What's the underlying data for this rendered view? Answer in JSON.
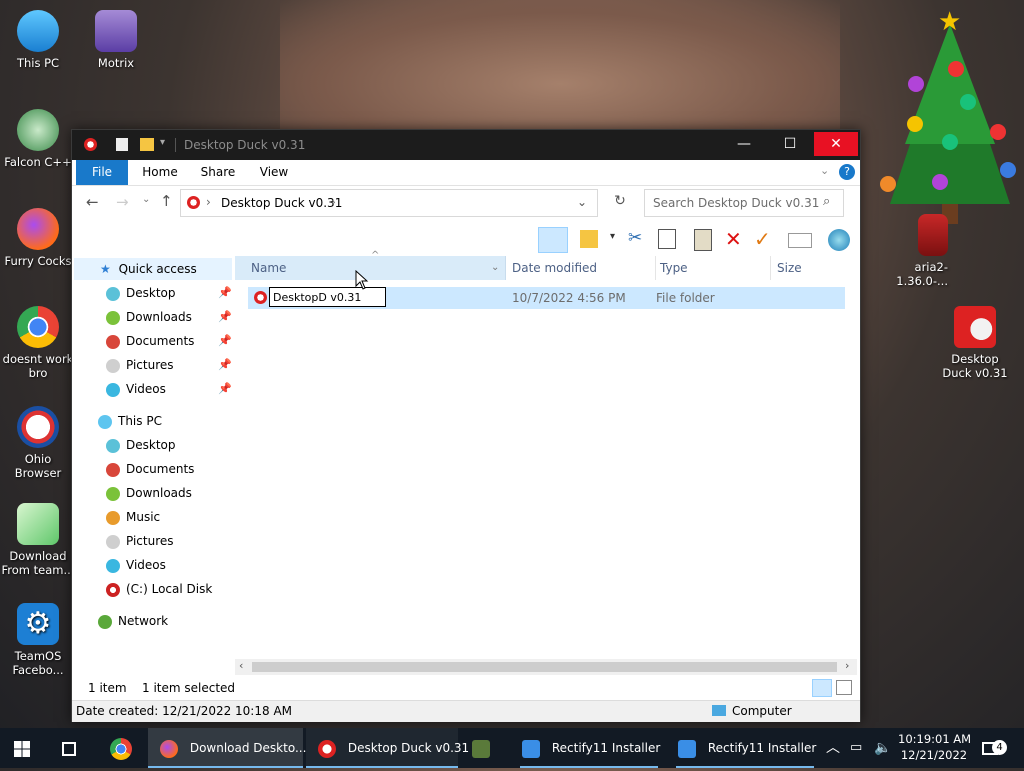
{
  "desktop": {
    "icons": [
      {
        "label": "This PC"
      },
      {
        "label": "Motrix"
      },
      {
        "label": "Falcon C++"
      },
      {
        "label": "Furry Cocks"
      },
      {
        "label": "doesnt work bro"
      },
      {
        "label": "Ohio Browser"
      },
      {
        "label": "Download From team..."
      },
      {
        "label": "TeamOS Facebo..."
      },
      {
        "label": "aria2-1.36.0-..."
      },
      {
        "label": "Desktop Duck v0.31"
      }
    ]
  },
  "window": {
    "title": "Desktop Duck v0.31",
    "ribbon_tabs": [
      "File",
      "Home",
      "Share",
      "View"
    ],
    "address": {
      "segment": "Desktop Duck v0.31"
    },
    "search_placeholder": "Search Desktop Duck v0.31",
    "columns": [
      "Name",
      "Date modified",
      "Type",
      "Size"
    ],
    "navigation": {
      "quick_access": "Quick access",
      "quick_items": [
        "Desktop",
        "Downloads",
        "Documents",
        "Pictures",
        "Videos"
      ],
      "this_pc": "This PC",
      "pc_items": [
        "Desktop",
        "Documents",
        "Downloads",
        "Music",
        "Pictures",
        "Videos",
        "(C:) Local Disk"
      ],
      "network": "Network"
    },
    "file": {
      "rename_value": "DesktopD v0.31",
      "date_modified": "10/7/2022 4:56 PM",
      "type": "File folder"
    },
    "status": {
      "count": "1 item",
      "selected": "1 item selected"
    },
    "details": {
      "date_created": "Date created: 12/21/2022 10:18 AM",
      "location": "Computer"
    }
  },
  "taskbar": {
    "items": [
      {
        "label": "Download Deskto..."
      },
      {
        "label": "Desktop Duck v0.31"
      },
      {
        "label": "Rectify11 Installer"
      },
      {
        "label": "Rectify11 Installer"
      }
    ],
    "clock": {
      "time": "10:19:01 AM",
      "date": "12/21/2022"
    },
    "notification_count": "4"
  },
  "colors": {
    "accent": "#1979ca",
    "selection": "#cce8ff",
    "close": "#e81123",
    "taskbar": "#121a24"
  }
}
